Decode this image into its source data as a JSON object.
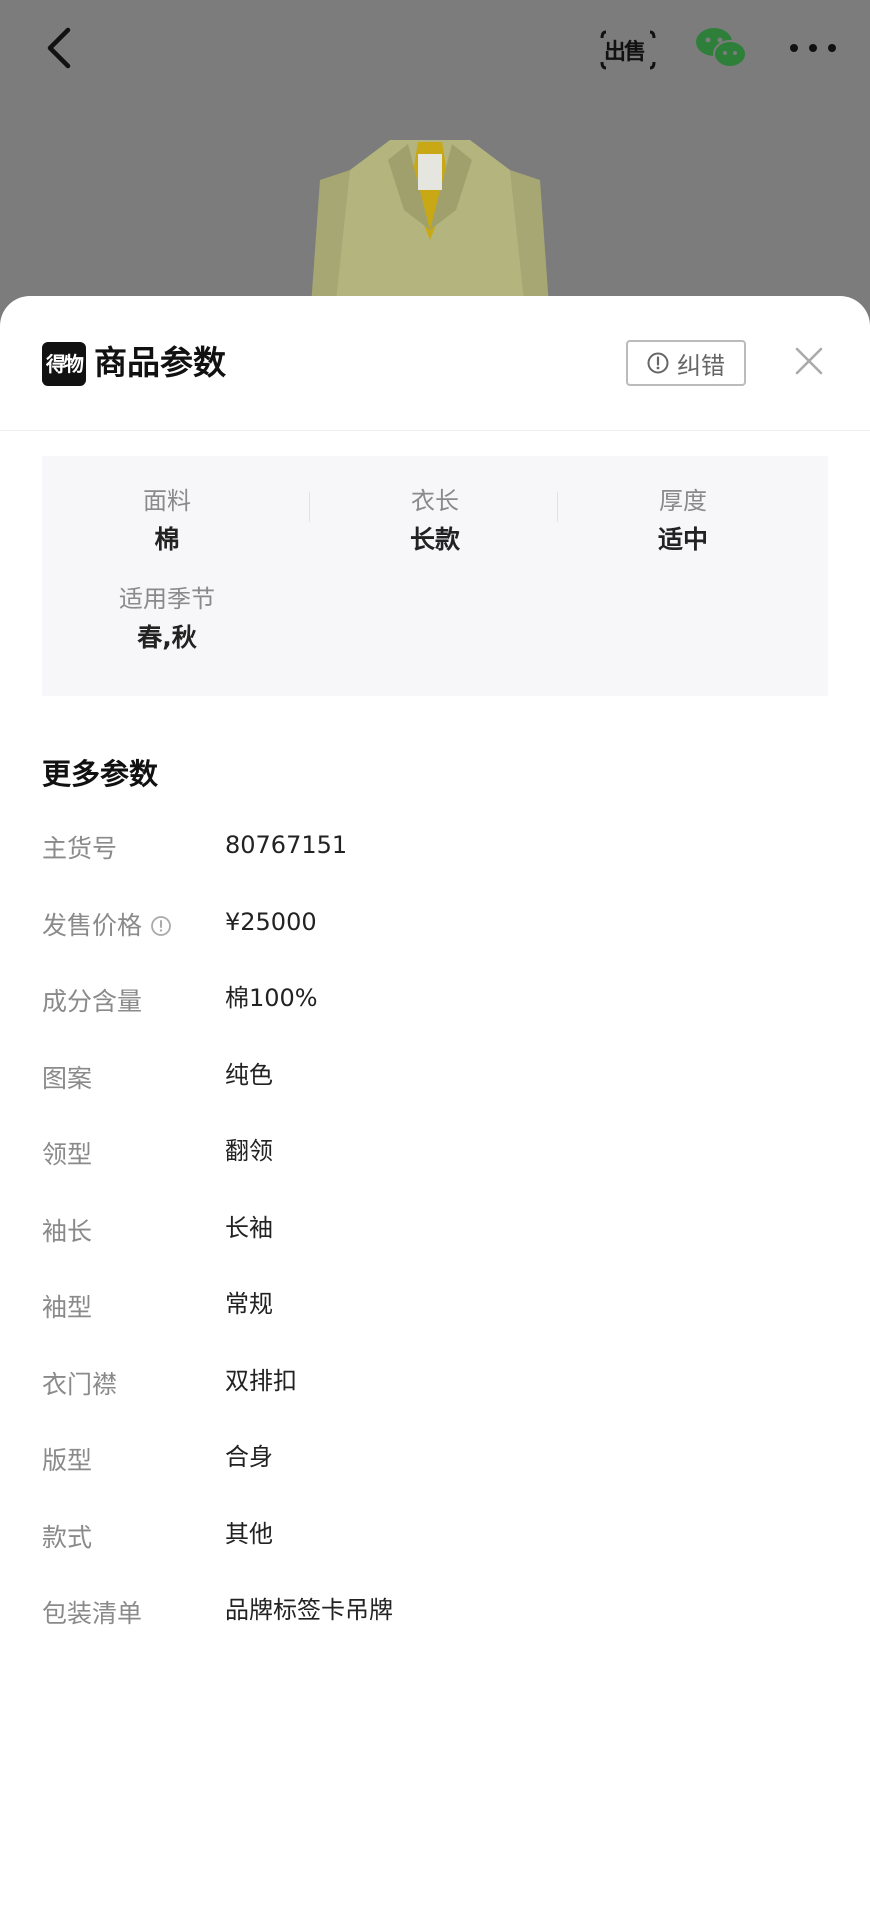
{
  "topbar": {
    "sell_icon_text": "出售",
    "icons": [
      "back-arrow-icon",
      "sell-icon",
      "wechat-icon",
      "more-icon"
    ]
  },
  "sheet": {
    "logo_text": "得物",
    "title": "商品参数",
    "report_label": "纠错"
  },
  "key_params": [
    {
      "label": "面料",
      "value": "棉"
    },
    {
      "label": "衣长",
      "value": "长款"
    },
    {
      "label": "厚度",
      "value": "适中"
    },
    {
      "label": "适用季节",
      "value": "春,秋"
    }
  ],
  "more_params": {
    "title": "更多参数",
    "rows": [
      {
        "key": "主货号",
        "value": "80767151"
      },
      {
        "key": "发售价格",
        "value": "¥25000",
        "info_icon": true
      },
      {
        "key": "成分含量",
        "value": "棉100%"
      },
      {
        "key": "图案",
        "value": "纯色"
      },
      {
        "key": "领型",
        "value": "翻领"
      },
      {
        "key": "袖长",
        "value": "长袖"
      },
      {
        "key": "袖型",
        "value": "常规"
      },
      {
        "key": "衣门襟",
        "value": "双排扣"
      },
      {
        "key": "版型",
        "value": "合身"
      },
      {
        "key": "款式",
        "value": "其他"
      },
      {
        "key": "包装清单",
        "value": "品牌标签卡吊牌"
      }
    ]
  },
  "colors": {
    "overlay": "#7c7c7c",
    "wechat_green": "#2d7f3a",
    "coat": "#b3b47e",
    "lining": "#c9a816"
  }
}
